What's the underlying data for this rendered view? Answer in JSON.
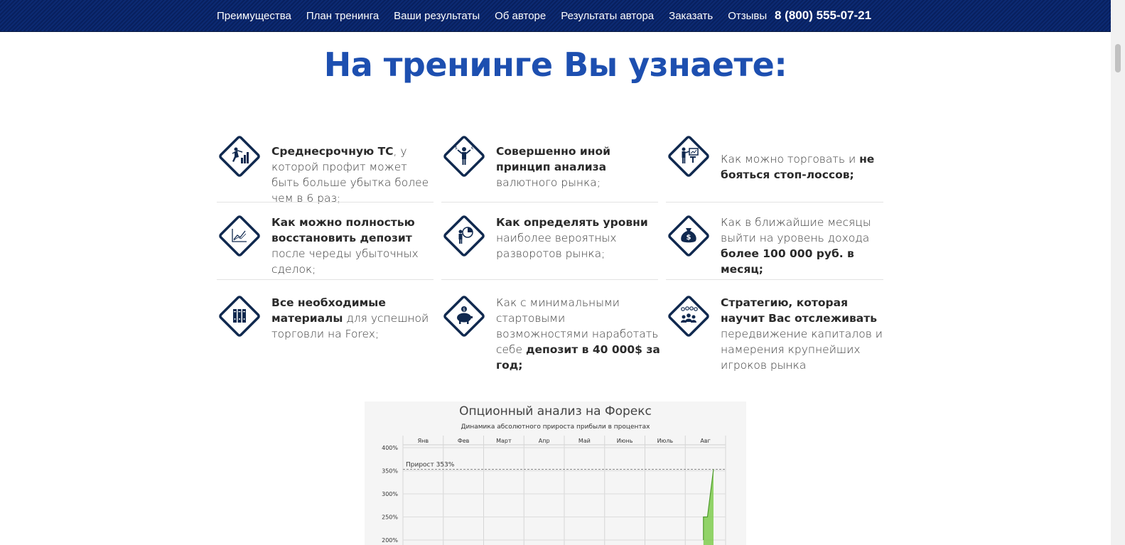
{
  "nav": {
    "items": [
      "Преимущества",
      "План тренинга",
      "Ваши результаты",
      "Об авторе",
      "Результаты автора",
      "Заказать",
      "Отзывы"
    ],
    "phone": "8 (800) 555-07-21"
  },
  "heading": "На тренинге Вы узнаете:",
  "features": [
    {
      "icon": "trader-chart-icon",
      "parts": [
        {
          "t": "Среднесрочную ТС",
          "b": true
        },
        {
          "t": ", у которой профит может быть больше убытка более чем в 6 раз;",
          "b": false
        }
      ]
    },
    {
      "icon": "currency-man-icon",
      "parts": [
        {
          "t": "Совершенно иной принцип анализа",
          "b": true
        },
        {
          "t": " валютного рынка;",
          "b": false
        }
      ]
    },
    {
      "icon": "presentation-icon",
      "parts": [
        {
          "t": "Как можно торговать и ",
          "b": false
        },
        {
          "t": "не бояться стоп-лоссов;",
          "b": true
        }
      ]
    },
    {
      "icon": "growth-chart-icon",
      "parts": [
        {
          "t": "Как можно полностью восстановить депозит",
          "b": true
        },
        {
          "t": " после череды убыточных сделок;",
          "b": false
        }
      ]
    },
    {
      "icon": "pie-chart-man-icon",
      "parts": [
        {
          "t": "Как определять уровни",
          "b": true
        },
        {
          "t": " наиболее вероятных разворотов рынка;",
          "b": false
        }
      ]
    },
    {
      "icon": "money-bag-icon",
      "parts": [
        {
          "t": "Как в ближайшие месяцы выйти на уровень дохода ",
          "b": false
        },
        {
          "t": "более 100 000 руб. в месяц;",
          "b": true
        }
      ]
    },
    {
      "icon": "books-icon",
      "parts": [
        {
          "t": "Все необходимые материалы",
          "b": true
        },
        {
          "t": " для успешной торговли на Forex;",
          "b": false
        }
      ]
    },
    {
      "icon": "piggy-bank-icon",
      "parts": [
        {
          "t": "Как с минимальными стартовыми возможностями наработать себе ",
          "b": false
        },
        {
          "t": "депозит в 40 000$ за год;",
          "b": true
        }
      ]
    },
    {
      "icon": "capital-flow-icon",
      "parts": [
        {
          "t": "Стратегию, которая научит Вас отслеживать",
          "b": true
        },
        {
          "t": " передвижение капиталов и намерения крупнейших игроков рынка",
          "b": false
        }
      ]
    }
  ],
  "colors": {
    "nav_bg": "#0c2a73",
    "heading": "#1d4fb0",
    "icon": "#10294f",
    "chart_fill": "#7fcc4f"
  },
  "chart_data": {
    "type": "area",
    "title": "Опционный анализ на Форекс",
    "subtitle": "Динамика абсолютного прироста прибыли в процентах",
    "categories": [
      "Янв",
      "Фев",
      "Март",
      "Апр",
      "Май",
      "Июнь",
      "Июль",
      "Авг"
    ],
    "y_ticks": [
      "400%",
      "350%",
      "300%",
      "250%",
      "200%"
    ],
    "ylim": [
      200,
      400
    ],
    "annotation": "Прирост 353%",
    "reference_line": 353,
    "series": [
      {
        "points": [
          {
            "x": 7.45,
            "y": 200
          },
          {
            "x": 7.45,
            "y": 250
          },
          {
            "x": 7.55,
            "y": 250
          },
          {
            "x": 7.7,
            "y": 353
          }
        ]
      }
    ],
    "grid": true
  }
}
